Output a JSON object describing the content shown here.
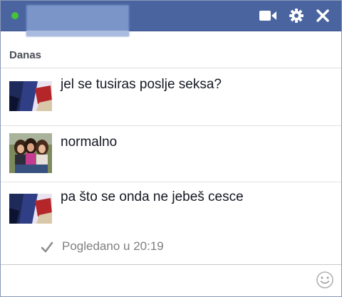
{
  "chat": {
    "contact_name": "",
    "day_label": "Danas",
    "messages": [
      {
        "text": "jel se tusiras poslje seksa?",
        "avatar": "contact-avatar-photo"
      },
      {
        "text": "normalno",
        "avatar": "user-avatar-photo"
      },
      {
        "text": "pa što se onda ne jebeš cesce",
        "avatar": "contact-avatar-photo"
      }
    ],
    "seen_text": "Pogledano u 20:19",
    "input_placeholder": ""
  },
  "titlebar": {
    "icons": [
      "video-call-icon",
      "gear-icon",
      "close-icon"
    ]
  },
  "colors": {
    "titlebar_bg": "#4a64a0",
    "online_green": "#46c33b",
    "seen_grey": "#7f7f7f"
  }
}
